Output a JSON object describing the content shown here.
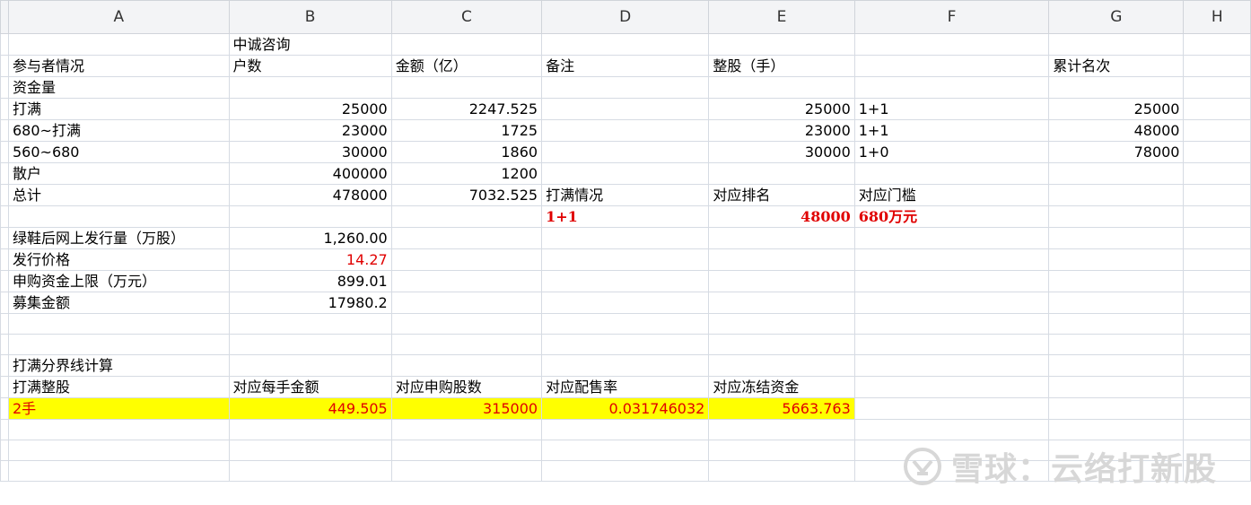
{
  "columns": [
    "A",
    "B",
    "C",
    "D",
    "E",
    "F",
    "G",
    "H"
  ],
  "rows": [
    [
      "",
      "中诚咨询",
      "",
      "",
      "",
      "",
      "",
      ""
    ],
    [
      "参与者情况",
      "户数",
      "金额（亿）",
      "备注",
      "整股（手）",
      "",
      "累计名次",
      ""
    ],
    [
      "资金量",
      "",
      "",
      "",
      "",
      "",
      "",
      ""
    ],
    [
      "打满",
      "25000",
      "2247.525",
      "",
      "25000",
      "1+1",
      "25000",
      ""
    ],
    [
      "680~打满",
      "23000",
      "1725",
      "",
      "23000",
      "1+1",
      "48000",
      ""
    ],
    [
      "560~680",
      "30000",
      "1860",
      "",
      "30000",
      "1+0",
      "78000",
      ""
    ],
    [
      "散户",
      "400000",
      "1200",
      "",
      "",
      "",
      "",
      ""
    ],
    [
      "总计",
      "478000",
      "7032.525",
      "打满情况",
      "对应排名",
      "对应门槛",
      "",
      ""
    ],
    [
      "",
      "",
      "",
      "1+1",
      "48000",
      "680万元",
      "",
      ""
    ],
    [
      "绿鞋后网上发行量（万股）",
      "1,260.00",
      "",
      "",
      "",
      "",
      "",
      ""
    ],
    [
      "发行价格",
      "14.27",
      "",
      "",
      "",
      "",
      "",
      ""
    ],
    [
      "申购资金上限（万元）",
      "899.01",
      "",
      "",
      "",
      "",
      "",
      ""
    ],
    [
      "募集金额",
      "17980.2",
      "",
      "",
      "",
      "",
      "",
      ""
    ],
    [
      "",
      "",
      "",
      "",
      "",
      "",
      "",
      ""
    ],
    [
      "",
      "",
      "",
      "",
      "",
      "",
      "",
      ""
    ],
    [
      "打满分界线计算",
      "",
      "",
      "",
      "",
      "",
      "",
      ""
    ],
    [
      "打满整股",
      "对应每手金额",
      "对应申购股数",
      "对应配售率",
      "对应冻结资金",
      "",
      "",
      ""
    ],
    [
      "2手",
      "449.505",
      "315000",
      "0.031746032",
      "5663.763",
      "",
      "",
      ""
    ],
    [
      "",
      "",
      "",
      "",
      "",
      "",
      "",
      ""
    ],
    [
      "",
      "",
      "",
      "",
      "",
      "",
      "",
      ""
    ],
    [
      "",
      "",
      "",
      "",
      "",
      "",
      "",
      ""
    ]
  ],
  "watermark": {
    "text": "雪球：云络打新股",
    "logo_icon": "snowball-logo-icon"
  },
  "colors": {
    "highlight": "#ffff00",
    "red_text": "#e00000",
    "grid": "#d6dbe3",
    "header_bg": "#f3f4f6"
  }
}
